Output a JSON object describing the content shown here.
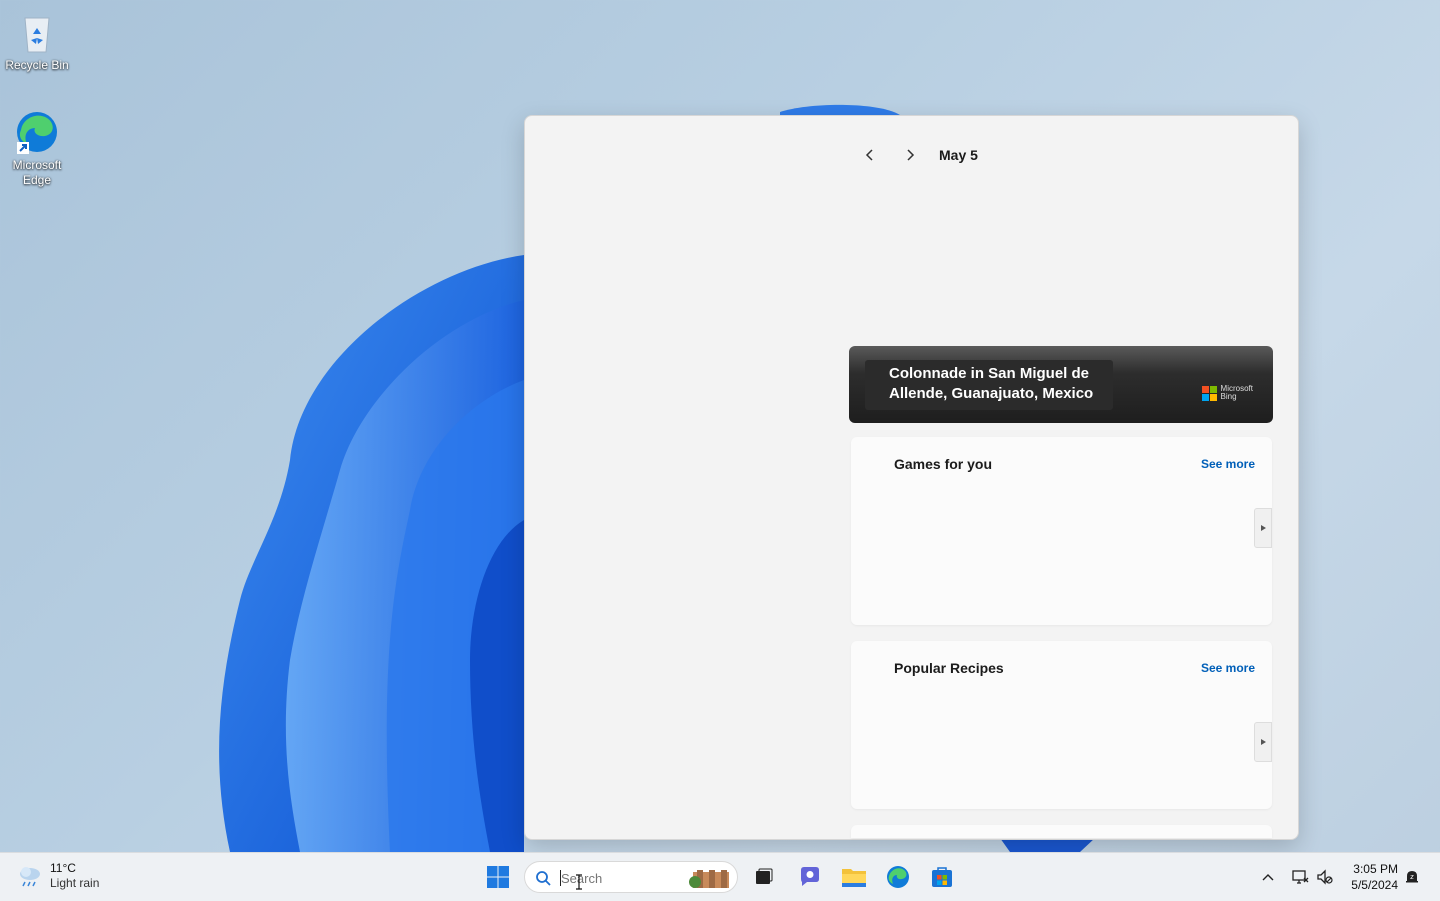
{
  "desktop": {
    "icons": [
      {
        "label": "Recycle Bin",
        "icon": "recycle-bin-icon"
      },
      {
        "label": "Microsoft Edge",
        "icon": "edge-icon"
      }
    ]
  },
  "widgets": {
    "date": "May 5",
    "hero": {
      "caption": "Colonnade in San Miguel de Allende, Guanajuato, Mexico",
      "brand_line1": "Microsoft",
      "brand_line2": "Bing"
    },
    "cards": [
      {
        "title": "Games for you",
        "see_more": "See more"
      },
      {
        "title": "Popular Recipes",
        "see_more": "See more"
      }
    ]
  },
  "taskbar": {
    "weather": {
      "temp": "11°C",
      "condition": "Light rain"
    },
    "search": {
      "placeholder": "Search",
      "value": ""
    },
    "apps": [
      "start-icon",
      "task-view-icon",
      "teams-chat-icon",
      "file-explorer-icon",
      "edge-icon",
      "store-icon"
    ],
    "clock": {
      "time": "3:05 PM",
      "date": "5/5/2024"
    }
  },
  "colors": {
    "accent": "#005fb8",
    "taskbar": "#eef1f4",
    "panel": "#f3f3f3"
  }
}
